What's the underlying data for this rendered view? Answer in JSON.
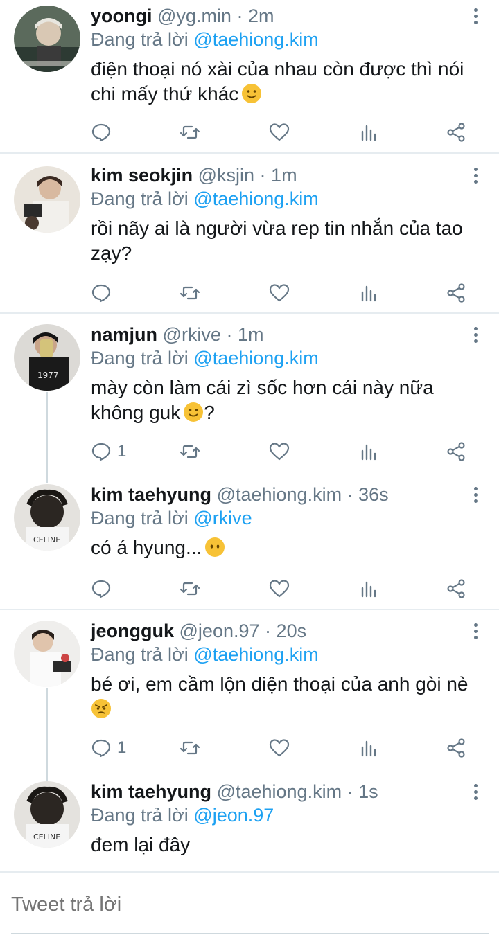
{
  "replying_label": "Đang trả lời",
  "tweets": [
    {
      "name": "yoongi",
      "handle": "@yg.min",
      "separator": "·",
      "time": "2m",
      "replying_to": "@taehiong.kim",
      "text": "điện thoại nó xài của nhau còn được thì nói chi mấy thứ khác",
      "emoji": "slightly-smiling-face",
      "reply_count": ""
    },
    {
      "name": "kim seokjin",
      "handle": "@ksjin",
      "separator": "·",
      "time": "1m",
      "replying_to": "@taehiong.kim",
      "text": "rồi nãy ai là người vừa rep tin nhắn của tao zạy?",
      "emoji": "",
      "reply_count": ""
    },
    {
      "name": "namjun",
      "handle": "@rkive",
      "separator": "·",
      "time": "1m",
      "replying_to": "@taehiong.kim",
      "text": "mày còn làm cái zì sốc hơn cái này nữa không guk",
      "text_after_emoji": "?",
      "emoji": "slightly-smiling-face",
      "reply_count": "1"
    },
    {
      "name": "kim taehyung",
      "handle": "@taehiong.kim",
      "separator": "·",
      "time": "36s",
      "replying_to": "@rkive",
      "text": "có á hyung...",
      "emoji": "face-without-mouth",
      "reply_count": ""
    },
    {
      "name": "jeongguk",
      "handle": "@jeon.97",
      "separator": "·",
      "time": "20s",
      "replying_to": "@taehiong.kim",
      "text": "bé ơi, em cầm lộn diện thoại của anh gòi nè",
      "emoji": "angry-face",
      "reply_count": "1"
    },
    {
      "name": "kim taehyung",
      "handle": "@taehiong.kim",
      "separator": "·",
      "time": "1s",
      "replying_to": "@jeon.97",
      "text": "đem lại đây",
      "emoji": "",
      "reply_count": ""
    }
  ],
  "action_icons": [
    "reply-icon",
    "retweet-icon",
    "like-icon",
    "analytics-icon",
    "share-icon"
  ],
  "composer": {
    "placeholder": "Tweet trả lời"
  },
  "colors": {
    "link": "#1da1f2",
    "muted": "#657786",
    "divider": "#e6ecf0",
    "emoji": "#f7c236"
  }
}
